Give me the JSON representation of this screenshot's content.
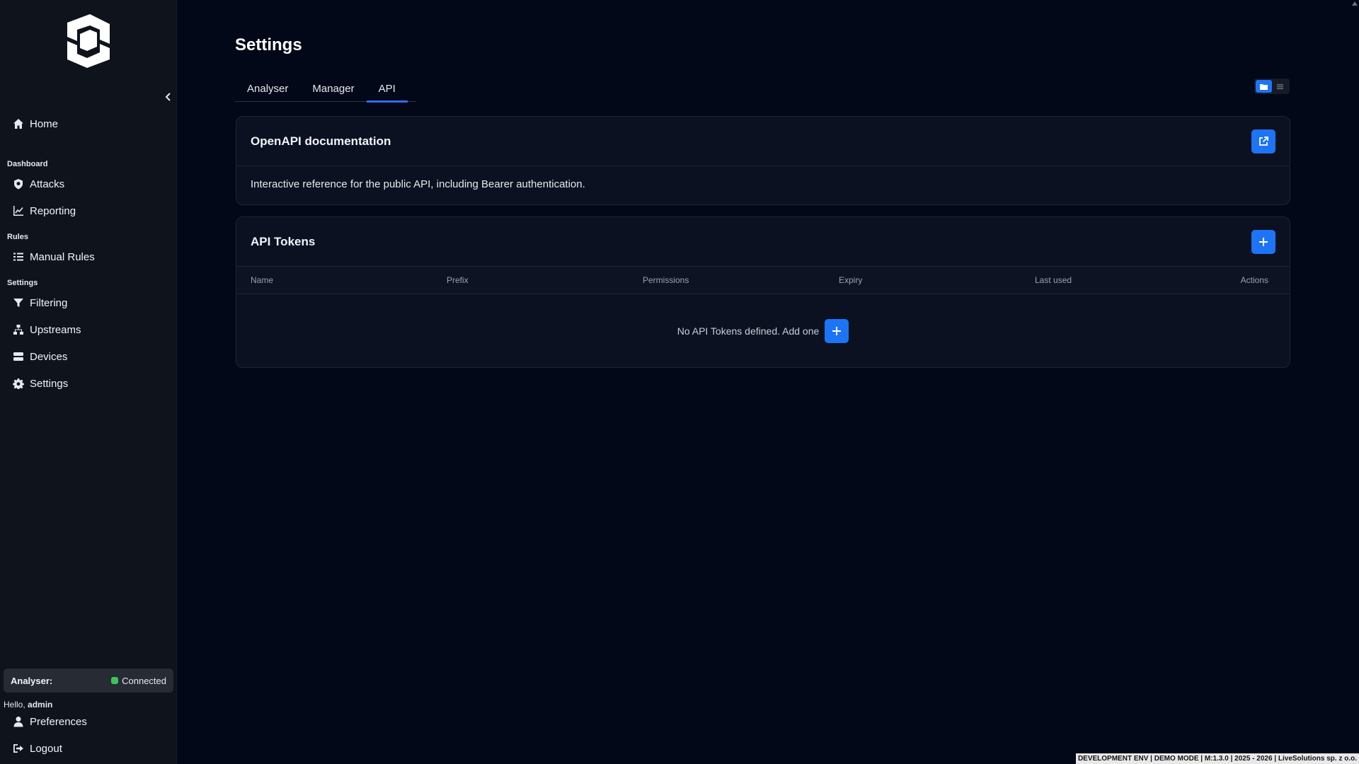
{
  "sidebar": {
    "home": "Home",
    "sections": {
      "dashboard": "Dashboard",
      "rules": "Rules",
      "settings": "Settings"
    },
    "items": {
      "attacks": "Attacks",
      "reporting": "Reporting",
      "manual_rules": "Manual Rules",
      "filtering": "Filtering",
      "upstreams": "Upstreams",
      "devices": "Devices",
      "settings": "Settings"
    },
    "analyser_label": "Analyser:",
    "analyser_status": "Connected",
    "hello_prefix": "Hello,",
    "username": "admin",
    "preferences": "Preferences",
    "logout": "Logout"
  },
  "page": {
    "title": "Settings",
    "tabs": [
      "Analyser",
      "Manager",
      "API"
    ],
    "active_tab": "API"
  },
  "openapi": {
    "title": "OpenAPI documentation",
    "description": "Interactive reference for the public API, including Bearer authentication."
  },
  "tokens": {
    "title": "API Tokens",
    "columns": [
      "Name",
      "Prefix",
      "Permissions",
      "Expiry",
      "Last used",
      "Actions"
    ],
    "empty_text": "No API Tokens defined. Add one"
  },
  "footer": "DEVELOPMENT ENV | DEMO MODE | M:1.3.0 | 2025 - 2026 | LiveSolutions sp. z o.o.",
  "colors": {
    "accent": "#1d74f5",
    "status_ok": "#3cc45a",
    "background": "#020817",
    "sidebar": "#0f131b"
  }
}
